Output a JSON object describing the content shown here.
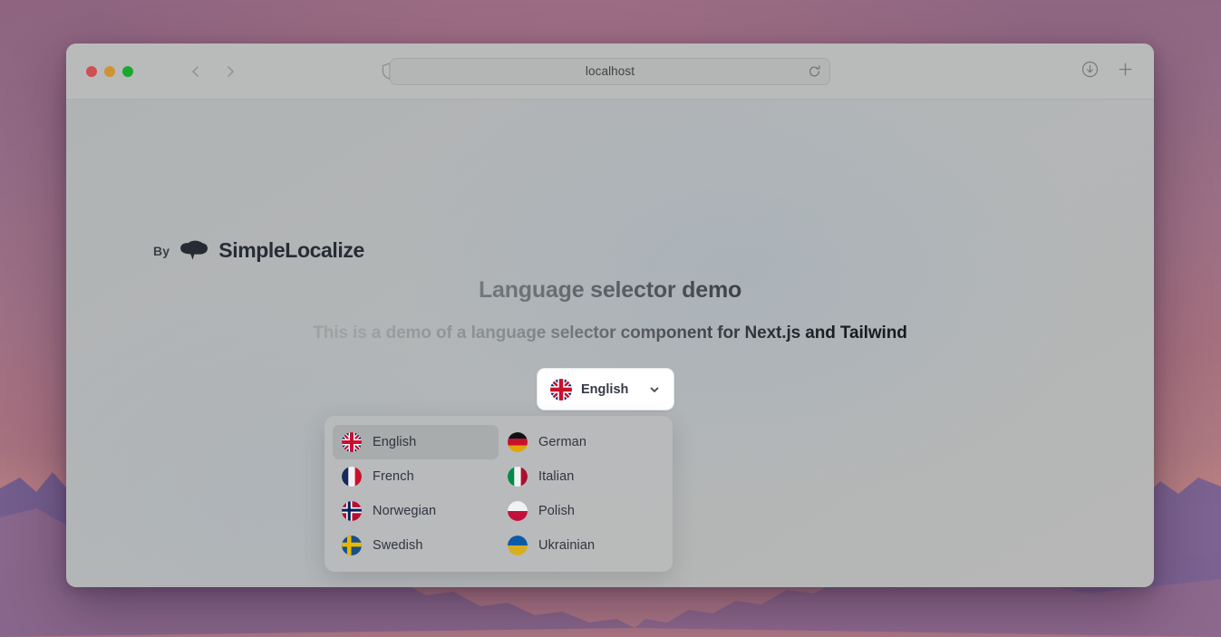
{
  "browser": {
    "url": "localhost",
    "traffic_lights": [
      "close-red",
      "minimize-yellow",
      "maximize-green"
    ],
    "icons": {
      "back": "chevron-left-icon",
      "forward": "chevron-right-icon",
      "shield": "shield-privacy-icon",
      "reload": "reload-icon",
      "downloads": "download-icon",
      "new_tab": "plus-icon"
    }
  },
  "page": {
    "brand_by": "By",
    "brand_name": "SimpleLocalize",
    "brand_mark": "cloud-speech-bubble-logo",
    "title": "Language selector demo",
    "subtitle": "This is a demo of a language selector component for Next.js and Tailwind"
  },
  "selector": {
    "selected_label": "English",
    "selected_flag": "flag-gb",
    "chevron": "chevron-down-icon",
    "expanded": true,
    "options": [
      {
        "label": "English",
        "flag": "flag-gb",
        "active": true
      },
      {
        "label": "German",
        "flag": "flag-de",
        "active": false
      },
      {
        "label": "French",
        "flag": "flag-fr",
        "active": false
      },
      {
        "label": "Italian",
        "flag": "flag-it",
        "active": false
      },
      {
        "label": "Norwegian",
        "flag": "flag-no",
        "active": false
      },
      {
        "label": "Polish",
        "flag": "flag-pl",
        "active": false
      },
      {
        "label": "Swedish",
        "flag": "flag-se",
        "active": false
      },
      {
        "label": "Ukrainian",
        "flag": "flag-ua",
        "active": false
      }
    ]
  },
  "colors": {
    "wallpaper_top": "#8e6480",
    "wallpaper_bottom": "#bb8585",
    "toolbar": "#b9bbbb",
    "page_bg": "#b3b6b7",
    "button_bg": "#ffffff",
    "dropdown_bg": "#babcbc",
    "text_dark": "#2f3440"
  }
}
